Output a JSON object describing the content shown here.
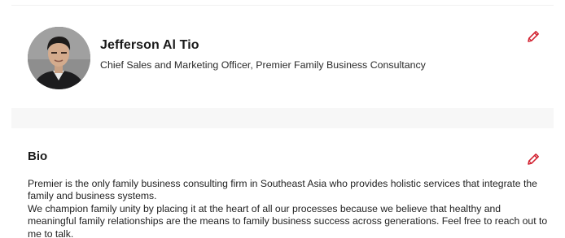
{
  "profile": {
    "name": "Jefferson Al Tio",
    "title": "Chief Sales and Marketing Officer, Premier Family Business Consultancy",
    "edit_icon": "pencil-icon"
  },
  "bio": {
    "heading": "Bio",
    "edit_icon": "pencil-icon",
    "paragraphs": [
      "Premier is the only family business consulting firm in Southeast Asia who provides holistic services that integrate the family and business systems.",
      "We champion family unity by placing it at the heart of all our processes because we believe that healthy and meaningful family relationships are the means to family business success across generations.  Feel free to reach out to me to talk."
    ]
  },
  "colors": {
    "accent": "#d2202f",
    "band": "#f7f7f7"
  }
}
